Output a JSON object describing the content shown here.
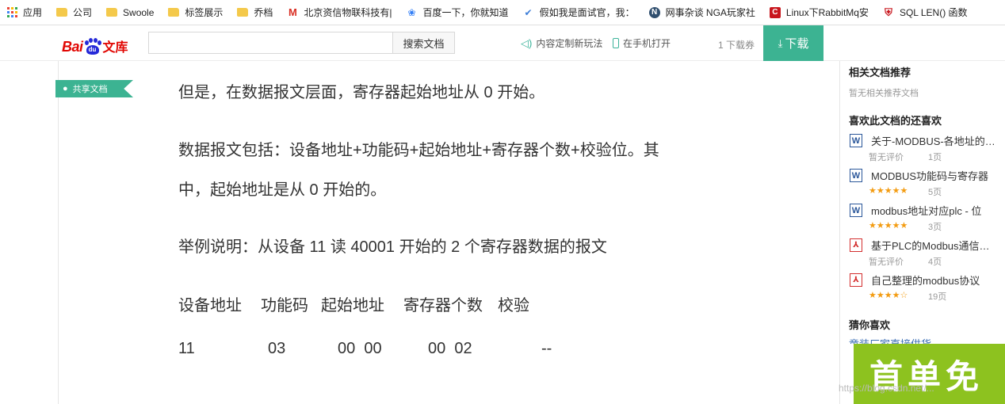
{
  "bookmarks": [
    {
      "label": "应用",
      "icon": "apps-icon"
    },
    {
      "label": "公司",
      "icon": "folder-icon"
    },
    {
      "label": "Swoole",
      "icon": "folder-icon"
    },
    {
      "label": "标签展示",
      "icon": "folder-icon"
    },
    {
      "label": "乔档",
      "icon": "folder-icon"
    },
    {
      "label": "北京资信物联科技有|",
      "icon": "gmail-icon"
    },
    {
      "label": "百度一下，你就知道",
      "icon": "baidu-paw-icon"
    },
    {
      "label": "假如我是面试官，我：",
      "icon": "checkmark-icon"
    },
    {
      "label": "网事杂谈 NGA玩家社",
      "icon": "nga-icon"
    },
    {
      "label": "Linux下RabbitMq安",
      "icon": "csdn-c-icon"
    },
    {
      "label": "SQL LEN() 函数",
      "icon": "shield-icon"
    }
  ],
  "header": {
    "logo_text_left": "Bai",
    "logo_paw_text": "du",
    "logo_text_right": "文库",
    "search_placeholder": "",
    "search_button": "搜索文档",
    "custom_link": "内容定制新玩法",
    "mobile_link": "在手机打开",
    "quota": "1 下载券",
    "download_button": "下载"
  },
  "share_tag": "共享文档",
  "document": {
    "lines": [
      "但是，在数据报文层面，寄存器起始地址从 0 开始。",
      "数据报文包括：设备地址+功能码+起始地址+寄存器个数+校验位。其",
      "中，起始地址是从 0 开始的。",
      "举例说明：从设备 11 读 40001 开始的 2 个寄存器数据的报文"
    ],
    "table_header": [
      "设备地址",
      "功能码",
      "起始地址",
      "寄存器个数",
      "校验"
    ],
    "table_row": [
      "11",
      "03",
      "00  00",
      "00  02",
      "--"
    ]
  },
  "sidebar": {
    "related_title": "相关文档推荐",
    "related_empty": "暂无相关推荐文档",
    "liked_title": "喜欢此文档的还喜欢",
    "recommendations": [
      {
        "title": "关于-MODBUS-各地址的…",
        "type": "word",
        "rating": "暂无评价",
        "pages": "1页"
      },
      {
        "title": "MODBUS功能码与寄存器",
        "type": "word",
        "rating": "★★★★★",
        "pages": "5页"
      },
      {
        "title": "modbus地址对应plc - 位",
        "type": "word",
        "rating": "★★★★★",
        "pages": "3页"
      },
      {
        "title": "基于PLC的Modbus通信…",
        "type": "pdf",
        "rating": "暂无评价",
        "pages": "4页"
      },
      {
        "title": "自己整理的modbus协议",
        "type": "pdf",
        "rating": "★★★★☆",
        "pages": "19页"
      }
    ],
    "guess_title": "猜你喜欢",
    "guess_item": "童装厂家直接供货"
  },
  "promo_text": "首单免",
  "watermark": "https://blog.csdn.net/..."
}
